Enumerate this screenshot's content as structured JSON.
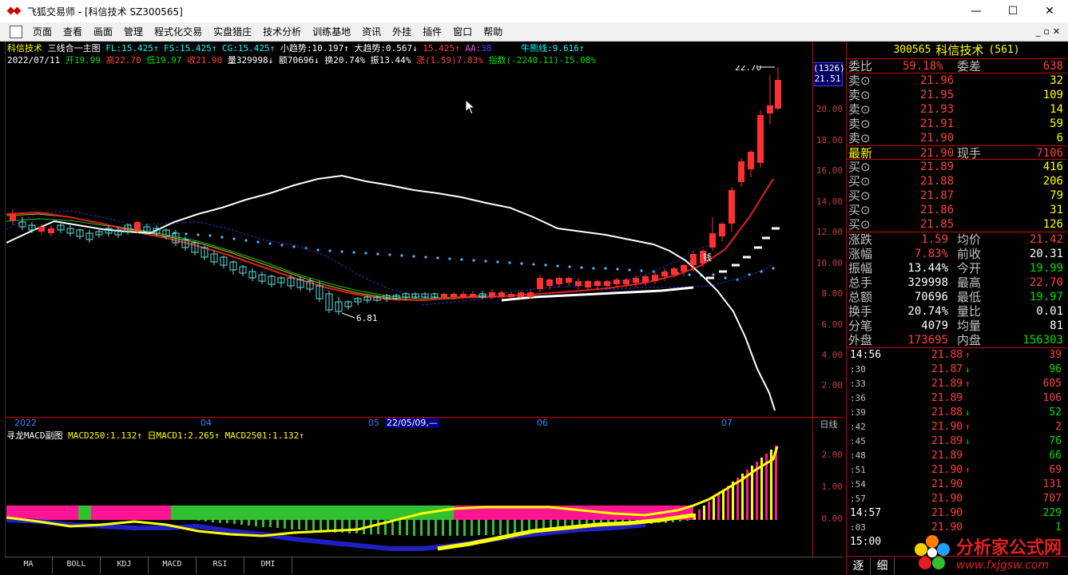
{
  "window": {
    "title": "飞狐交易师 - [科信技术 SZ300565]"
  },
  "menu": [
    "页面",
    "查看",
    "画面",
    "管理",
    "程式化交易",
    "实盘猎庄",
    "技术分析",
    "训练基地",
    "资讯",
    "外挂",
    "插件",
    "窗口",
    "帮助"
  ],
  "main_chart": {
    "stats1": {
      "name": "科信技术",
      "indicator": "三线合一主图",
      "fl": "FL:15.425↑",
      "fs": "FS:15.425↑",
      "cg": "CG:15.425↑",
      "small": "小趋势:10.197↑",
      "big": "大趋势:0.567↓",
      "v1": "15.425↑",
      "aa": "AA:",
      "aa_val": "38",
      "bear": "牛熊线:9.616↑"
    },
    "stats2": {
      "date": "2022/07/11",
      "open": "开19.99",
      "high": "高22.70",
      "low": "低19.97",
      "close": "收21.90",
      "vol": "量329998↓",
      "amt": "额70696↓",
      "turn": "换20.74%",
      "amp": "振13.44%",
      "chg": "涨(1.59)7.83%",
      "idx": "指数(-2240.11)-15.08%"
    },
    "high_label": "22.70",
    "low_label": "6.81",
    "money_label": "钱",
    "price_box_top": "(1326)",
    "price_box_bottom": "21.51",
    "price_labels": [
      "20.00",
      "18.00",
      "16.00",
      "14.00",
      "12.00",
      "10.00",
      "8.00",
      "6.00",
      "4.00",
      "2.00"
    ],
    "date_labels": [
      "2022",
      "04",
      "05",
      "22/05/09,—",
      "06",
      "07"
    ],
    "cycle": "日线"
  },
  "sub_chart": {
    "title": "寻龙MACD副图",
    "macd250": "MACD250:1.132↑",
    "macd1": "日MACD1:2.265↑",
    "macd2501": "MACD2501:1.132↑",
    "axis": [
      "2.00",
      "1.00",
      "0.00"
    ]
  },
  "bottom_tabs": [
    "MA",
    "BOLL",
    "KDJ",
    "MACD",
    "RSI",
    "DMI"
  ],
  "quote": {
    "code": "300565",
    "name": "科信技术",
    "num": "(561)",
    "wb_label": "委比",
    "wb_val": "59.18%",
    "wc_label": "委差",
    "wc_val": "638",
    "sell": [
      {
        "label": "卖⊙",
        "price": "21.96",
        "vol": "32"
      },
      {
        "label": "卖⊙",
        "price": "21.95",
        "vol": "109"
      },
      {
        "label": "卖⊙",
        "price": "21.93",
        "vol": "14"
      },
      {
        "label": "卖⊙",
        "price": "21.91",
        "vol": "59"
      },
      {
        "label": "卖⊙",
        "price": "21.90",
        "vol": "6"
      }
    ],
    "latest_label": "最新",
    "latest_val": "21.90",
    "xs_label": "现手",
    "xs_val": "7106",
    "buy": [
      {
        "label": "买⊙",
        "price": "21.89",
        "vol": "416"
      },
      {
        "label": "买⊙",
        "price": "21.88",
        "vol": "206"
      },
      {
        "label": "买⊙",
        "price": "21.87",
        "vol": "79"
      },
      {
        "label": "买⊙",
        "price": "21.86",
        "vol": "31"
      },
      {
        "label": "买⊙",
        "price": "21.85",
        "vol": "126"
      }
    ],
    "stats": [
      {
        "l1": "涨跌",
        "v1": "1.59",
        "c1": "red",
        "l2": "均价",
        "v2": "21.42",
        "c2": "red"
      },
      {
        "l1": "涨幅",
        "v1": "7.83%",
        "c1": "red",
        "l2": "前收",
        "v2": "20.31",
        "c2": "white"
      },
      {
        "l1": "振幅",
        "v1": "13.44%",
        "c1": "white",
        "l2": "今开",
        "v2": "19.99",
        "c2": "green"
      },
      {
        "l1": "总手",
        "v1": "329998",
        "c1": "white",
        "l2": "最高",
        "v2": "22.70",
        "c2": "red"
      },
      {
        "l1": "总额",
        "v1": "70696",
        "c1": "white",
        "l2": "最低",
        "v2": "19.97",
        "c2": "green"
      },
      {
        "l1": "换手",
        "v1": "20.74%",
        "c1": "white",
        "l2": "量比",
        "v2": "0.01",
        "c2": "white"
      },
      {
        "l1": "分笔",
        "v1": "4079",
        "c1": "white",
        "l2": "均量",
        "v2": "81",
        "c2": "white"
      },
      {
        "l1": "外盘",
        "v1": "173695",
        "c1": "red",
        "l2": "内盘",
        "v2": "156303",
        "c2": "green"
      }
    ],
    "trades": [
      {
        "t": "14:56",
        "big": true,
        "p": "21.88",
        "arrow": "↑",
        "pc": "red",
        "v": "39",
        "vc": "red"
      },
      {
        "t": ":30",
        "big": false,
        "p": "21.87",
        "arrow": "↓",
        "pc": "red",
        "v": "96",
        "vc": "green"
      },
      {
        "t": ":33",
        "big": false,
        "p": "21.89",
        "arrow": "↑",
        "pc": "red",
        "v": "605",
        "vc": "red"
      },
      {
        "t": ":36",
        "big": false,
        "p": "21.89",
        "arrow": "",
        "pc": "red",
        "v": "106",
        "vc": "red"
      },
      {
        "t": ":39",
        "big": false,
        "p": "21.88",
        "arrow": "↓",
        "pc": "red",
        "v": "52",
        "vc": "green"
      },
      {
        "t": ":42",
        "big": false,
        "p": "21.90",
        "arrow": "↑",
        "pc": "red",
        "v": "2",
        "vc": "red"
      },
      {
        "t": ":45",
        "big": false,
        "p": "21.89",
        "arrow": "↓",
        "pc": "red",
        "v": "76",
        "vc": "green"
      },
      {
        "t": ":48",
        "big": false,
        "p": "21.89",
        "arrow": "",
        "pc": "red",
        "v": "66",
        "vc": "green"
      },
      {
        "t": ":51",
        "big": false,
        "p": "21.90",
        "arrow": "↑",
        "pc": "red",
        "v": "69",
        "vc": "red"
      },
      {
        "t": ":54",
        "big": false,
        "p": "21.90",
        "arrow": "",
        "pc": "red",
        "v": "131",
        "vc": "red"
      },
      {
        "t": ":57",
        "big": false,
        "p": "21.90",
        "arrow": "",
        "pc": "red",
        "v": "707",
        "vc": "red"
      },
      {
        "t": "14:57",
        "big": true,
        "p": "21.90",
        "arrow": "",
        "pc": "red",
        "v": "229",
        "vc": "green"
      },
      {
        "t": ":03",
        "big": false,
        "p": "21.90",
        "arrow": "",
        "pc": "red",
        "v": "1",
        "vc": "green"
      },
      {
        "t": "15:00",
        "big": true,
        "p": "",
        "arrow": "",
        "pc": "red",
        "v": "",
        "vc": "green"
      }
    ],
    "footer": [
      "逐",
      "细"
    ]
  },
  "watermark": {
    "line1": "分析家公式网",
    "line2": "www.fxjgsw.com"
  }
}
